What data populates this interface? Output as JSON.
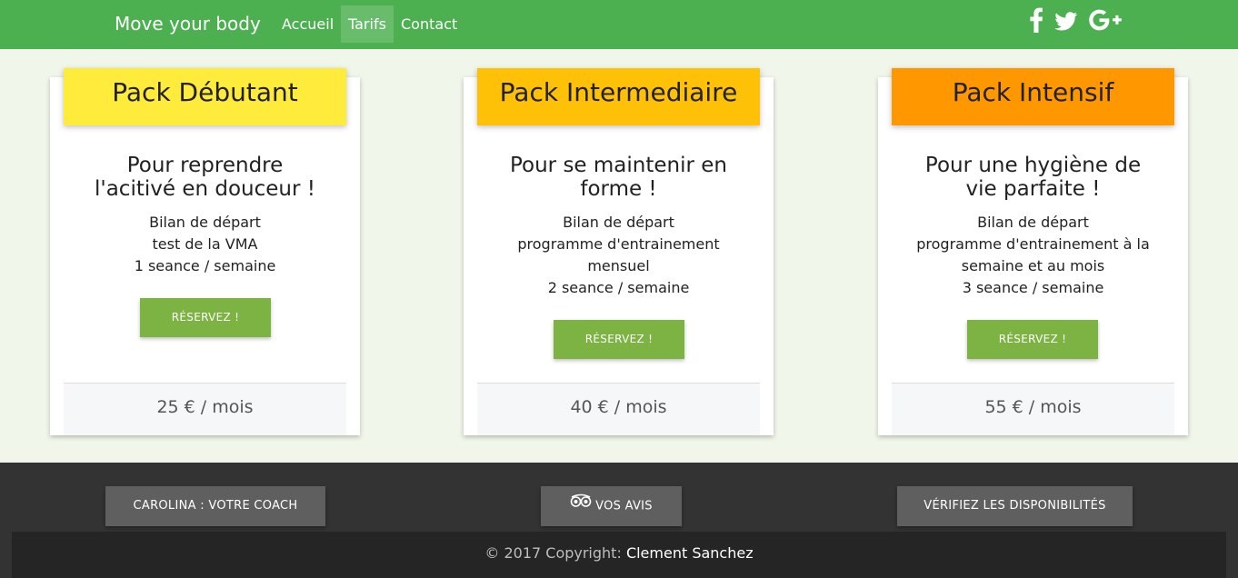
{
  "navbar": {
    "brand": "Move your body",
    "links": [
      {
        "label": "Accueil",
        "active": false
      },
      {
        "label": "Tarifs",
        "active": true
      },
      {
        "label": "Contact",
        "active": false
      }
    ],
    "social_icons": [
      "facebook-icon",
      "twitter-icon",
      "google-plus-icon"
    ],
    "color": "#4caf50"
  },
  "packs": [
    {
      "title": "Pack Débutant",
      "subtitle_lines": [
        "Pour reprendre",
        "l'acitivé en douceur !"
      ],
      "features": [
        "Bilan de départ",
        "test de la VMA",
        "1 seance / semaine"
      ],
      "button": "RÉSERVEZ !",
      "price": "25 € / mois",
      "color": "#ffeb3b"
    },
    {
      "title": "Pack Intermediaire",
      "subtitle_lines": [
        "Pour se maintenir en",
        "forme !"
      ],
      "features": [
        "Bilan de départ",
        "programme d'entrainement",
        "mensuel",
        "2 seance / semaine"
      ],
      "button": "RÉSERVEZ !",
      "price": "40 € / mois",
      "color": "#ffc107"
    },
    {
      "title": "Pack Intensif",
      "subtitle_lines": [
        "Pour une hygiène de",
        "vie parfaite !"
      ],
      "features": [
        "Bilan de départ",
        "programme d'entrainement à la",
        "semaine et au mois",
        "3 seance / semaine"
      ],
      "button": "RÉSERVEZ !",
      "price": "55 € / mois",
      "color": "#ff9800"
    }
  ],
  "footer": {
    "buttons": {
      "coach": "CAROLINA : VOTRE COACH",
      "avis": "VOS AVIS",
      "dispo": "VÉRIFIEZ LES DISPONIBILITÉS"
    },
    "avis_icon": "tripadvisor-icon",
    "copyright_prefix": "© 2017 Copyright:",
    "copyright_name": "Clement Sanchez"
  },
  "accent_button_color": "#7cb342"
}
